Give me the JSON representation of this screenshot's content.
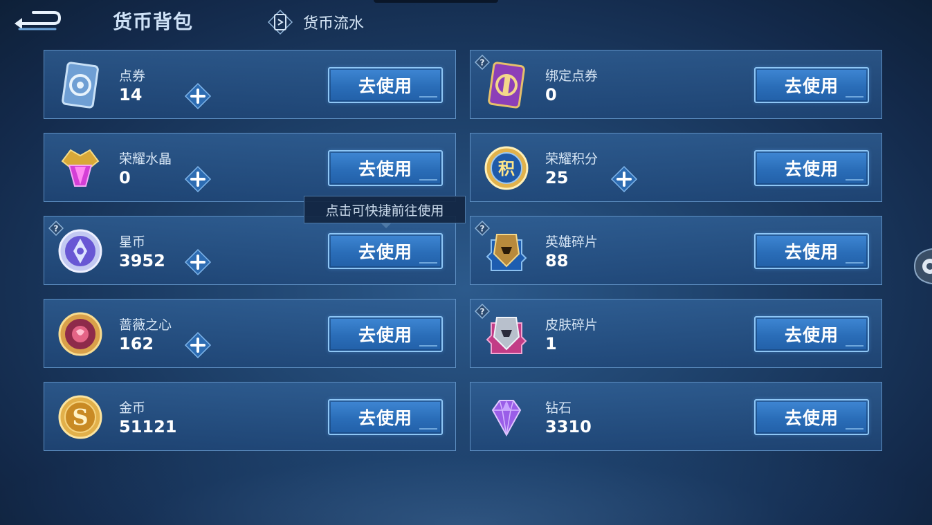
{
  "header": {
    "title": "货币背包",
    "flow_tab": "货币流水"
  },
  "tooltip": "点击可快捷前往使用",
  "cards": [
    {
      "name": "点券",
      "amount": "14",
      "button": "去使用",
      "icon": "coupon-card-icon",
      "has_plus": true,
      "has_help": false
    },
    {
      "name": "绑定点券",
      "amount": "0",
      "button": "去使用",
      "icon": "bound-coupon-card-icon",
      "has_plus": false,
      "has_help": true
    },
    {
      "name": "荣耀水晶",
      "amount": "0",
      "button": "去使用",
      "icon": "glory-crystal-icon",
      "has_plus": true,
      "has_help": false
    },
    {
      "name": "荣耀积分",
      "amount": "25",
      "button": "去使用",
      "icon": "glory-points-icon",
      "has_plus": true,
      "has_help": false
    },
    {
      "name": "星币",
      "amount": "3952",
      "button": "去使用",
      "icon": "star-coin-icon",
      "has_plus": true,
      "has_help": true
    },
    {
      "name": "英雄碎片",
      "amount": "88",
      "button": "去使用",
      "icon": "hero-fragment-icon",
      "has_plus": false,
      "has_help": true
    },
    {
      "name": "蔷薇之心",
      "amount": "162",
      "button": "去使用",
      "icon": "rose-heart-icon",
      "has_plus": true,
      "has_help": false
    },
    {
      "name": "皮肤碎片",
      "amount": "1",
      "button": "去使用",
      "icon": "skin-fragment-icon",
      "has_plus": false,
      "has_help": true
    },
    {
      "name": "金币",
      "amount": "51121",
      "button": "去使用",
      "icon": "gold-coin-icon",
      "has_plus": false,
      "has_help": false
    },
    {
      "name": "钻石",
      "amount": "3310",
      "button": "去使用",
      "icon": "diamond-icon",
      "has_plus": false,
      "has_help": false
    }
  ],
  "colors": {
    "button_blue": "#2f78c6",
    "button_border": "#8ec6f5",
    "card_border": "#5e8fc2",
    "background": "#1d3f68"
  }
}
